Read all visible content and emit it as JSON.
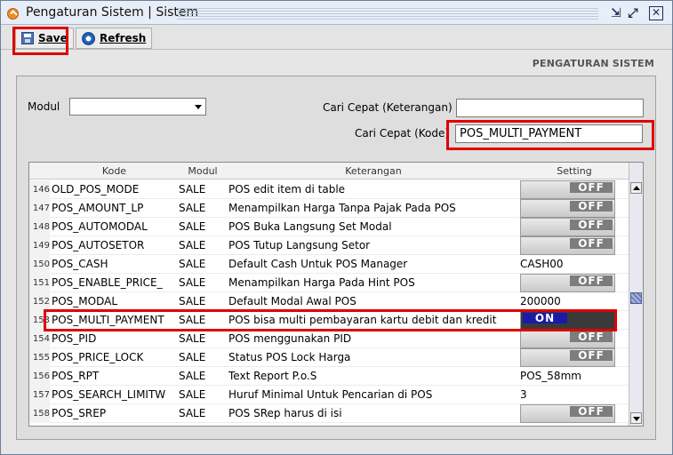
{
  "window": {
    "title": "Pengaturan Sistem | Sistem"
  },
  "toolbar": {
    "save_label": "Save",
    "refresh_label": "Refresh"
  },
  "section_title": "PENGATURAN SISTEM",
  "filters": {
    "modul_label": "Modul",
    "modul_value": "",
    "cari_keterangan_label": "Cari Cepat (Keterangan)",
    "cari_keterangan_value": "",
    "cari_kode_label": "Cari Cepat (Kode)",
    "cari_kode_value": "POS_MULTI_PAYMENT"
  },
  "grid": {
    "columns": [
      "Kode",
      "Modul",
      "Keterangan",
      "Setting"
    ],
    "rows": [
      {
        "num": "146",
        "kode": "OLD_POS_MODE",
        "modul": "SALE",
        "ket": "POS edit item di table",
        "setting": "OFF"
      },
      {
        "num": "147",
        "kode": "POS_AMOUNT_LP",
        "modul": "SALE",
        "ket": "Menampilkan Harga Tanpa Pajak Pada POS",
        "setting": "OFF"
      },
      {
        "num": "148",
        "kode": "POS_AUTOMODAL",
        "modul": "SALE",
        "ket": "POS Buka Langsung Set Modal",
        "setting": "OFF"
      },
      {
        "num": "149",
        "kode": "POS_AUTOSETOR",
        "modul": "SALE",
        "ket": "POS Tutup Langsung Setor",
        "setting": "OFF"
      },
      {
        "num": "150",
        "kode": "POS_CASH",
        "modul": "SALE",
        "ket": "Default Cash Untuk POS Manager",
        "setting": "CASH00"
      },
      {
        "num": "151",
        "kode": "POS_ENABLE_PRICE_",
        "modul": "SALE",
        "ket": "Menampilkan Harga Pada Hint POS",
        "setting": "OFF"
      },
      {
        "num": "152",
        "kode": "POS_MODAL",
        "modul": "SALE",
        "ket": "Default Modal Awal POS",
        "setting": "200000"
      },
      {
        "num": "153",
        "kode": "POS_MULTI_PAYMENT",
        "modul": "SALE",
        "ket": "POS bisa multi pembayaran kartu debit dan kredit",
        "setting": "ON"
      },
      {
        "num": "154",
        "kode": "POS_PID",
        "modul": "SALE",
        "ket": "POS menggunakan PID",
        "setting": "OFF"
      },
      {
        "num": "155",
        "kode": "POS_PRICE_LOCK",
        "modul": "SALE",
        "ket": "Status POS Lock Harga",
        "setting": "OFF"
      },
      {
        "num": "156",
        "kode": "POS_RPT",
        "modul": "SALE",
        "ket": "Text Report P.o.S",
        "setting": "POS_58mm"
      },
      {
        "num": "157",
        "kode": "POS_SEARCH_LIMITW",
        "modul": "SALE",
        "ket": "Huruf Minimal Untuk Pencarian di POS",
        "setting": "3"
      },
      {
        "num": "158",
        "kode": "POS_SREP",
        "modul": "SALE",
        "ket": "POS SRep harus di isi",
        "setting": "OFF"
      }
    ]
  },
  "icons": {
    "app": "app-icon",
    "save": "save-icon",
    "refresh": "refresh-icon",
    "restore": "restore-icon",
    "maximize": "maximize-icon",
    "close": "close-icon"
  },
  "colors": {
    "highlight_box": "#e00000",
    "toggle_on": "#1a1aa8",
    "toggle_off": "#7d7d7d"
  }
}
